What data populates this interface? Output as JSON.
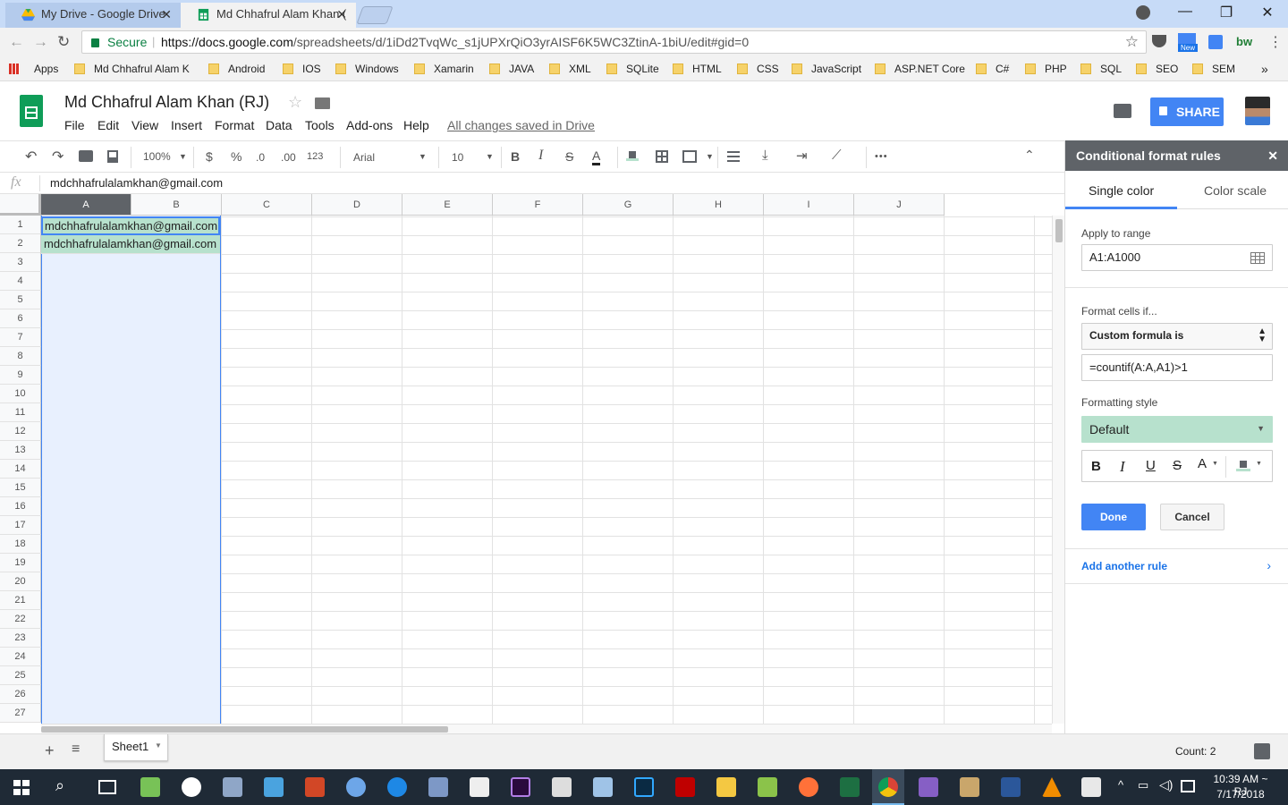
{
  "browser": {
    "tabs": [
      {
        "title": "My Drive - Google Drive",
        "close": "✕"
      },
      {
        "title": "Md Chhafrul Alam Khan (",
        "close": "✕"
      }
    ],
    "window_buttons": {
      "minimize": "—",
      "maximize": "❐",
      "close": "✕"
    },
    "secure_label": "Secure",
    "url_host": "https://docs.google.com",
    "url_path": "/spreadsheets/d/1iDd2TvqWc_s1jUPXrQiO3yrAISF6K5WC3ZtinA-1biU/edit#gid=0",
    "extension_badge": "New",
    "extension_text": "bw",
    "bookmarks": [
      "Apps",
      "Md Chhafrul Alam K",
      "Android",
      "IOS",
      "Windows",
      "Xamarin",
      "JAVA",
      "XML",
      "SQLite",
      "HTML",
      "CSS",
      "JavaScript",
      "ASP.NET Core",
      "C#",
      "PHP",
      "SQL",
      "SEO",
      "SEM"
    ]
  },
  "sheets": {
    "doc_title": "Md Chhafrul Alam Khan (RJ)",
    "menu": [
      "File",
      "Edit",
      "View",
      "Insert",
      "Format",
      "Data",
      "Tools",
      "Add-ons",
      "Help"
    ],
    "save_status": "All changes saved in Drive",
    "share_label": "SHARE",
    "toolbar": {
      "zoom": "100%",
      "currency": "$",
      "percent": "%",
      "dec_less": ".0",
      "dec_more": ".00",
      "more_formats": "123",
      "font": "Arial",
      "font_size": "10",
      "bold": "B",
      "italic": "I",
      "strike": "S",
      "text_color": "A",
      "more": "•••"
    },
    "formula_bar": {
      "fx": "fx",
      "value": "mdchhafrulalamkhan@gmail.com"
    },
    "columns": [
      "A",
      "B",
      "C",
      "D",
      "E",
      "F",
      "G",
      "H",
      "I",
      "J"
    ],
    "rows": [
      "1",
      "2",
      "3",
      "4",
      "5",
      "6",
      "7",
      "8",
      "9",
      "10",
      "11",
      "12",
      "13",
      "14",
      "15",
      "16",
      "17",
      "18",
      "19",
      "20",
      "21",
      "22",
      "23",
      "24",
      "25",
      "26",
      "27"
    ],
    "cells": {
      "A1": "mdchhafrulalamkhan@gmail.com",
      "A2": "mdchhafrulalamkhan@gmail.com"
    },
    "sheet_tab": "Sheet1",
    "status_count": "Count: 2"
  },
  "panel": {
    "title": "Conditional format rules",
    "close": "✕",
    "tabs": [
      "Single color",
      "Color scale"
    ],
    "apply_label": "Apply to range",
    "range_value": "A1:A1000",
    "condition_label": "Format cells if...",
    "condition_value": "Custom formula is",
    "formula_value": "=countif(A:A,A1)>1",
    "style_label": "Formatting style",
    "style_value": "Default",
    "style_color": "#b7e1cd",
    "style_buttons": {
      "bold": "B",
      "italic": "I",
      "underline": "U",
      "strike": "S",
      "text_color": "A"
    },
    "done_label": "Done",
    "cancel_label": "Cancel",
    "add_rule_label": "Add another rule"
  },
  "taskbar": {
    "time": "10:39 AM ~ RJ",
    "date": "7/17/2018"
  },
  "colors": {
    "accent": "#4285f4",
    "sheets_green": "#0f9d58",
    "selection_fill": "#e8f0fe",
    "match_fill": "#b7e1cd",
    "panel_header": "#5f6368"
  }
}
